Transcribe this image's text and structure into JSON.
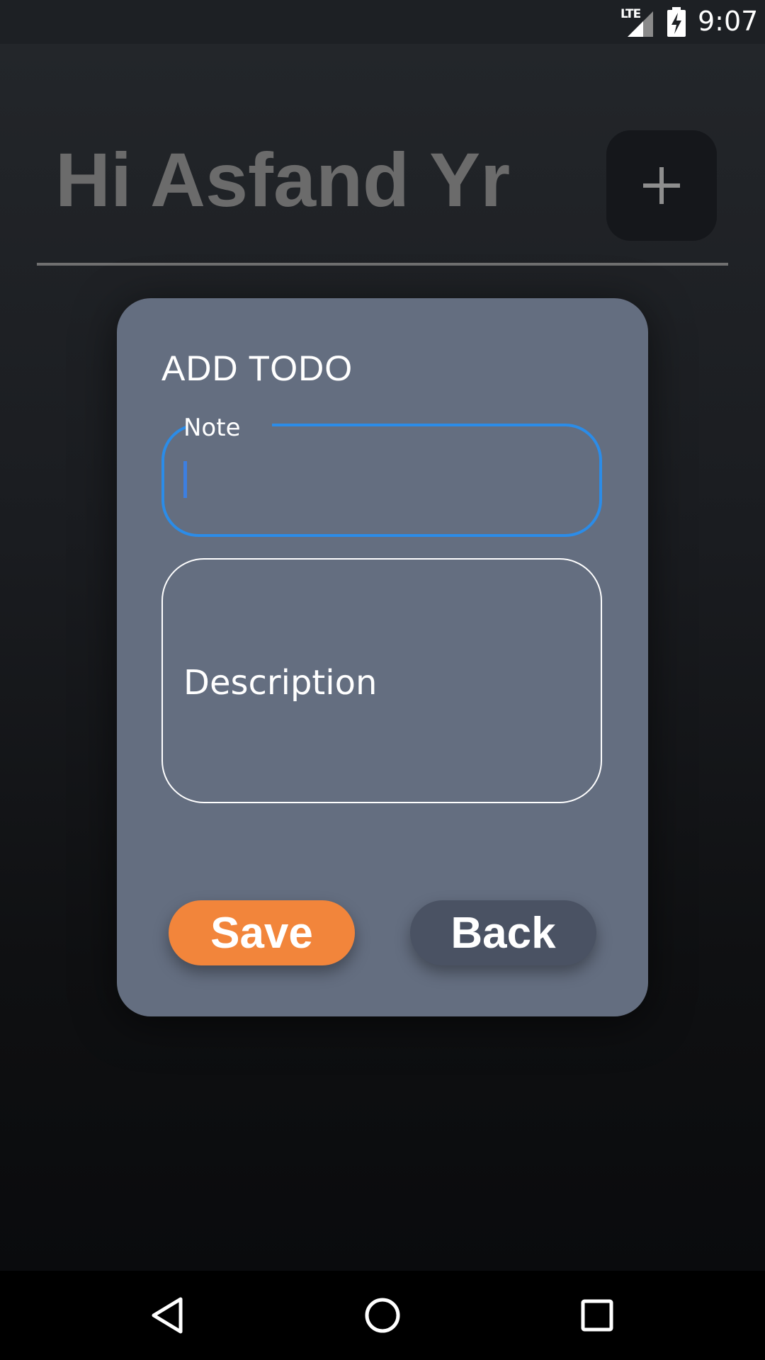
{
  "status_bar": {
    "network": "LTE",
    "time": "9:07",
    "icons": [
      "signal-icon",
      "battery-charging-icon"
    ]
  },
  "header": {
    "greeting": "Hi Asfand Yr",
    "add_button_icon": "plus-icon"
  },
  "dialog": {
    "title": "ADD TODO",
    "note_field": {
      "label": "Note",
      "value": ""
    },
    "description_field": {
      "placeholder": "Description",
      "value": ""
    },
    "save_label": "Save",
    "back_label": "Back"
  },
  "nav_bar": {
    "icons": [
      "back-triangle-icon",
      "home-circle-icon",
      "recents-square-icon"
    ]
  },
  "colors": {
    "dialog_bg": "#646e80",
    "save_button": "#f2853b",
    "back_button": "#4a5263",
    "focus_border": "#2b8ce8",
    "greeting_text": "#6b6b6b"
  }
}
